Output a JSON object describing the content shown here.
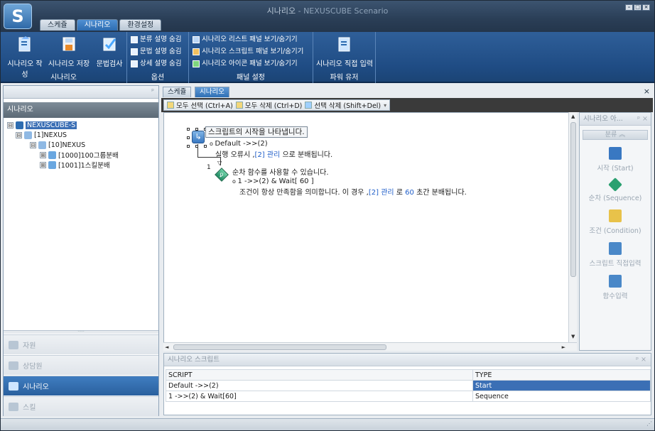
{
  "window": {
    "title": "시나리오",
    "subtitle": " - NEXUSCUBE Scenario",
    "logo_letter": "S"
  },
  "tabs": [
    "스케쥴",
    "시나리오",
    "환경설정"
  ],
  "ribbon": {
    "group_scenario": {
      "label": "시나리오",
      "buttons": [
        "시나리오 작성",
        "시나리오 저장",
        "문법검사"
      ]
    },
    "group_options": {
      "label": "옵션",
      "items": [
        "분류 설명 숨김",
        "문법 설명 숨김",
        "상세 설명 숨김"
      ]
    },
    "group_panel": {
      "label": "패널 설정",
      "items": [
        "시나리오 리스트 패널 보기/숨기기",
        "시나리오 스크립트 패널 보기/숨기기",
        "시나리오 아이콘 패널 보기/숨기기"
      ]
    },
    "group_power": {
      "label": "파워 유저",
      "button": "시나리오 직접 입력"
    }
  },
  "left_panel": {
    "pin": "ᵖ",
    "header": "시나리오",
    "tree": [
      {
        "label": "NEXUSCUBE-S",
        "level": 0,
        "selected": true,
        "exp": "⊟"
      },
      {
        "label": "[1]NEXUS",
        "level": 1,
        "selected": false,
        "exp": "⊟"
      },
      {
        "label": "[10]NEXUS",
        "level": 2,
        "selected": false,
        "exp": "⊟"
      },
      {
        "label": "[1000]100그룹분배",
        "level": 3,
        "selected": false,
        "exp": "⊞"
      },
      {
        "label": "[1001]1스킬분배",
        "level": 3,
        "selected": false,
        "exp": "⊞"
      }
    ],
    "nav": [
      "자원",
      "상담원",
      "시나리오",
      "스킬"
    ]
  },
  "doc_tabs": [
    "스케쥴",
    "시나리오"
  ],
  "toolbar": {
    "select_all": "모두 선택 (Ctrl+A)",
    "delete_all": "모두 삭제 (Ctrl+D)",
    "delete_selected": "선택 삭제 (Shift+Del)"
  },
  "flow": {
    "start_tooltip": "스크립트의 시작을 나타냅니다.",
    "default_line": "Default ->>(2)",
    "default_desc_prefix": "실행 오류시 ,",
    "default_desc_link": "[2] 관리",
    "default_desc_suffix": " 으로 분배됩니다.",
    "step_no": "1",
    "seq_desc": "순차 함수를 사용할 수 있습니다.",
    "seq_line": "1 ->>(2) & Wait[ 60 ]",
    "seq_cond_prefix": "조건이 항상 만족함을 의미합니다. 이 경우 ,",
    "seq_cond_link": "[2] 관리",
    "seq_cond_mid": " 로 ",
    "seq_cond_num": "60",
    "seq_cond_suffix": " 초간 분배됩니다."
  },
  "palette": {
    "title": "시나리오 아...",
    "group": "분류",
    "items": [
      "시작 (Start)",
      "순차 (Sequence)",
      "조건 (Condition)",
      "스크립트 직접입력",
      "함수입력"
    ]
  },
  "script_panel": {
    "title": "시나리오 스크립트",
    "columns": [
      "SCRIPT",
      "TYPE"
    ],
    "rows": [
      {
        "script": "Default ->>(2)",
        "type": "Start"
      },
      {
        "script": "1 ->>(2) & Wait[60]",
        "type": "Sequence"
      }
    ]
  },
  "colors": {
    "accent": "#2d6cb1",
    "ribbon": "#1f4c84",
    "selection": "#3b6fb5"
  }
}
